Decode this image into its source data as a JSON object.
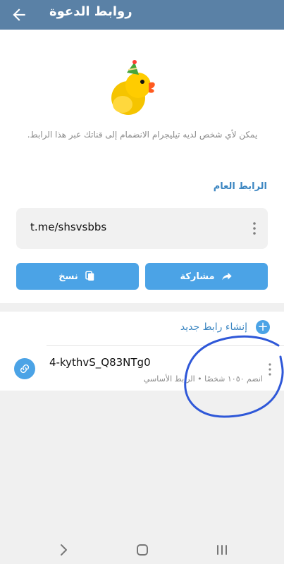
{
  "header": {
    "title": "روابط الدعوة"
  },
  "hero": {
    "hint": "يمكن لأي شخص لديه تيليجرام الانضمام إلى قناتك عبر هذا الرابط."
  },
  "public_link": {
    "section_title": "الرابط العام",
    "url": "t.me/shsvsbbs",
    "copy_label": "نسخ",
    "share_label": "مشاركة"
  },
  "invite_links": {
    "create_label": "إنشاء رابط جديد",
    "item": {
      "code": "4-kythvS_Q83NTg0",
      "meta": "انضم ١٠٥٠ شخصًا • الرابط الأساسي"
    }
  },
  "colors": {
    "header": "#5a81a6",
    "accent": "#4ba3e6",
    "section_title": "#3d87c2",
    "annotation": "#2f58d8"
  }
}
